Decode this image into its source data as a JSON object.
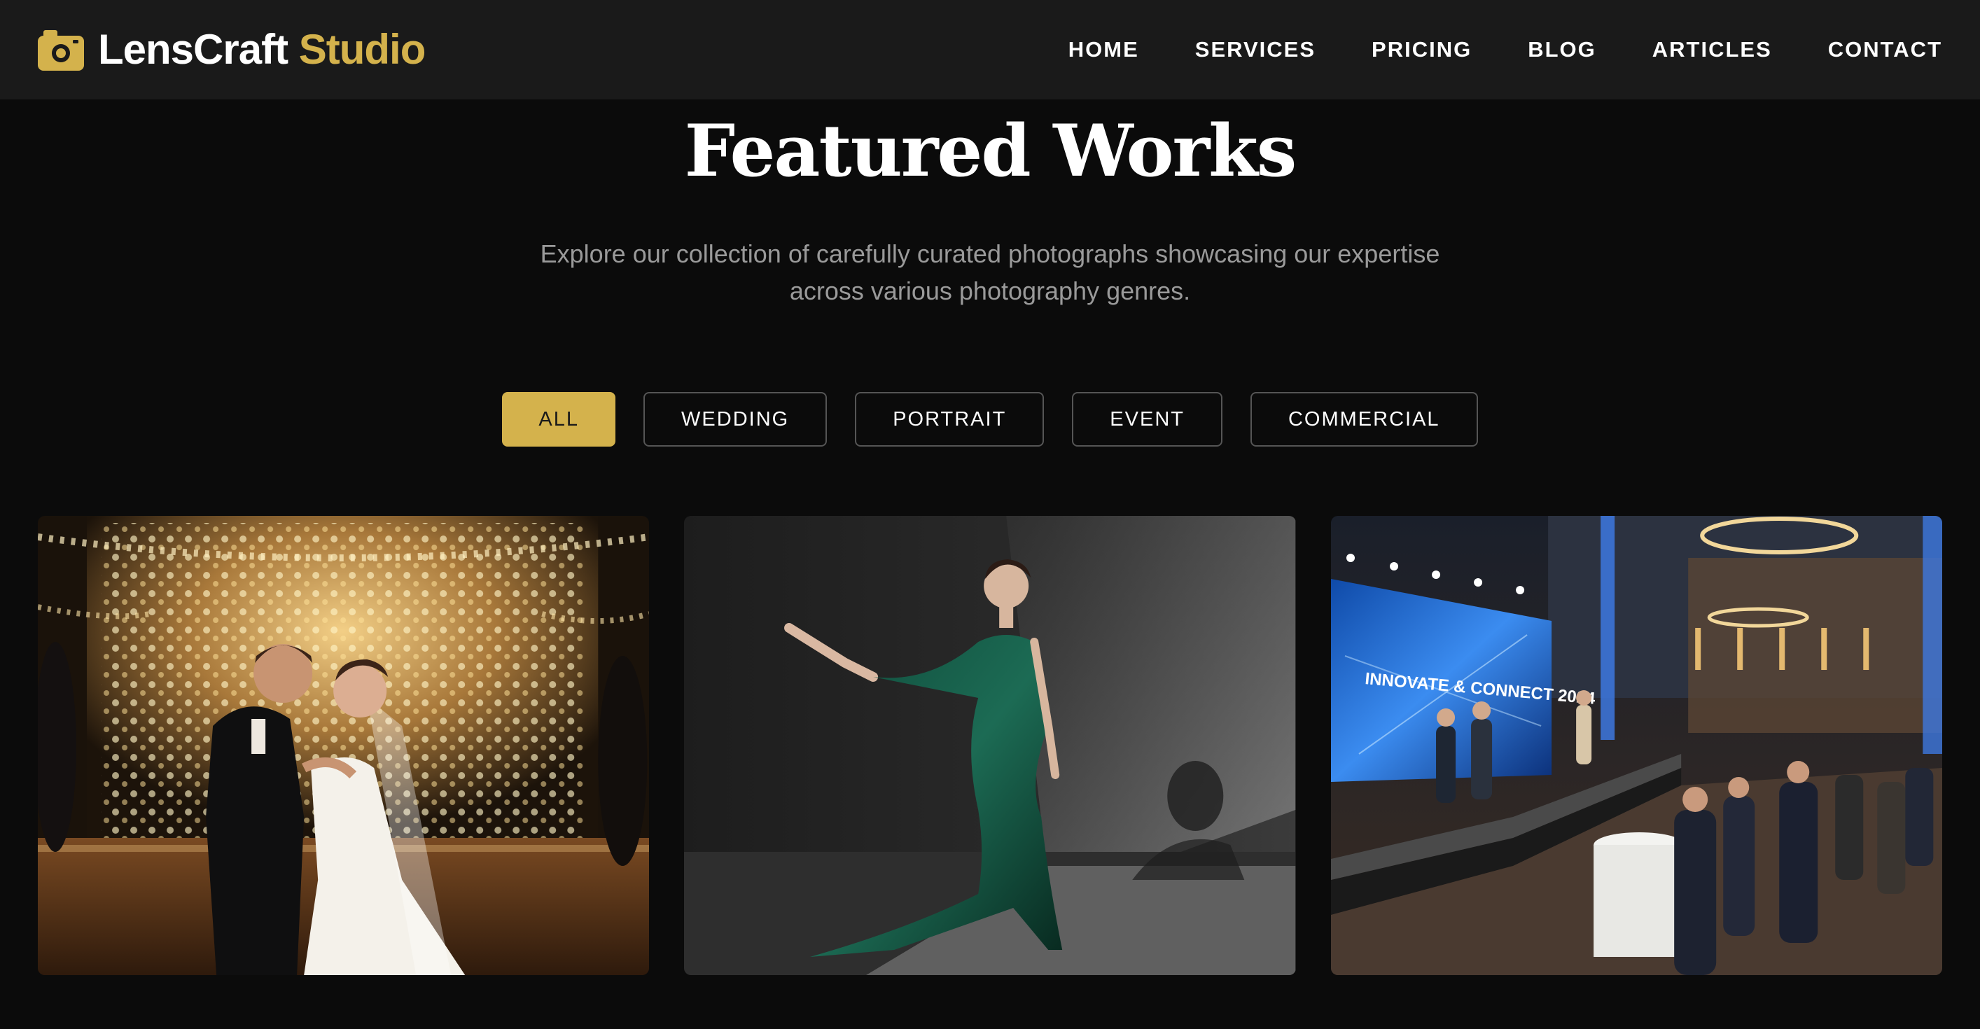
{
  "brand": {
    "name": "LensCraft",
    "accent": "Studio",
    "icon": "camera-icon",
    "accent_color": "#d4b24c"
  },
  "nav": {
    "items": [
      {
        "label": "HOME"
      },
      {
        "label": "SERVICES"
      },
      {
        "label": "PRICING"
      },
      {
        "label": "BLOG"
      },
      {
        "label": "ARTICLES"
      },
      {
        "label": "CONTACT"
      }
    ]
  },
  "hero": {
    "title": "Featured Works",
    "subtitle": "Explore our collection of carefully curated photographs showcasing our expertise across various photography genres."
  },
  "filters": {
    "active": "ALL",
    "items": [
      {
        "label": "ALL"
      },
      {
        "label": "WEDDING"
      },
      {
        "label": "PORTRAIT"
      },
      {
        "label": "EVENT"
      },
      {
        "label": "COMMERCIAL"
      }
    ]
  },
  "gallery": {
    "items": [
      {
        "category": "wedding"
      },
      {
        "category": "portrait"
      },
      {
        "category": "event",
        "screen_text": "INNOVATE & CONNECT 2024"
      }
    ]
  }
}
